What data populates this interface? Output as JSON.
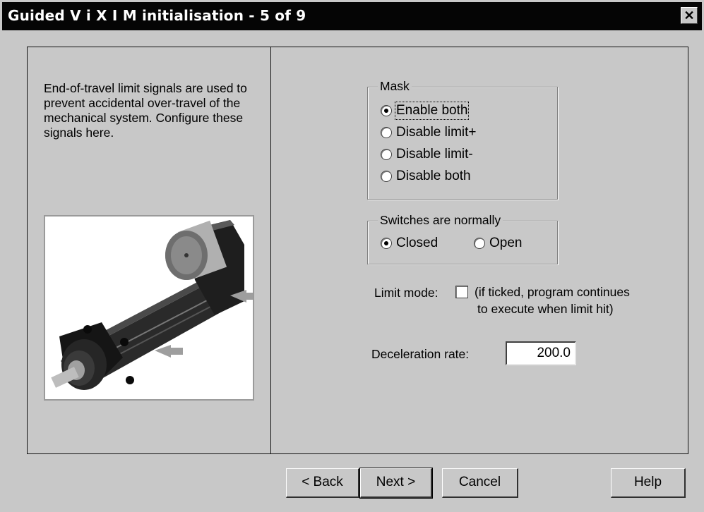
{
  "window": {
    "title": "Guided V i X I M initialisation - 5 of 9",
    "close_glyph": "✕"
  },
  "description": "End-of-travel limit signals are used to prevent accidental over-travel of the mechanical system. Configure these signals here.",
  "mask_group": {
    "legend": "Mask",
    "options": [
      {
        "label": "Enable both",
        "checked": true
      },
      {
        "label": "Disable limit+",
        "checked": false
      },
      {
        "label": "Disable limit-",
        "checked": false
      },
      {
        "label": "Disable both",
        "checked": false
      }
    ]
  },
  "switches_group": {
    "legend": "Switches are normally",
    "options": [
      {
        "label": "Closed",
        "checked": true
      },
      {
        "label": "Open",
        "checked": false
      }
    ]
  },
  "limit_mode": {
    "label": "Limit mode:",
    "checked": false,
    "hint_line1": "(if ticked, program continues",
    "hint_line2": "to execute when limit hit)"
  },
  "deceleration": {
    "label": "Deceleration rate:",
    "value": "200.0"
  },
  "buttons": {
    "back": "< Back",
    "next": "Next >",
    "cancel": "Cancel",
    "help": "Help"
  },
  "colors": {
    "dialog_bg": "#c8c8c8",
    "titlebar_bg": "#050505",
    "titlebar_text": "#ffffff"
  },
  "icons": {
    "close": "close-icon",
    "illustration": "linear-actuator-illustration"
  }
}
